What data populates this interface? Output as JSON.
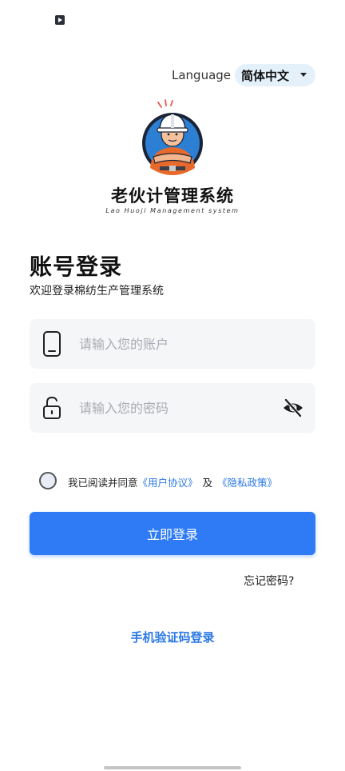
{
  "status_bar": {
    "icon": "media-play-icon"
  },
  "language": {
    "label": "Language",
    "value": "简体中文"
  },
  "brand": {
    "title": "老伙计管理系统",
    "subtitle": "Lao Huoji Management system"
  },
  "login": {
    "title": "账号登录",
    "subtitle": "欢迎登录棉纺生产管理系统",
    "account_placeholder": "请输入您的账户",
    "password_placeholder": "请输入您的密码",
    "agreement": {
      "prefix": "我已阅读并同意",
      "user_agreement": "《用户协议》",
      "and": "及",
      "privacy_policy": "《隐私政策》"
    },
    "submit_label": "立即登录",
    "forgot_label": "忘记密码?",
    "sms_login_label": "手机验证码登录"
  },
  "colors": {
    "primary": "#2f7bf6",
    "link": "#2b78e4",
    "language_pill": "#e4f1fb",
    "input_bg": "#f5f6f8"
  }
}
